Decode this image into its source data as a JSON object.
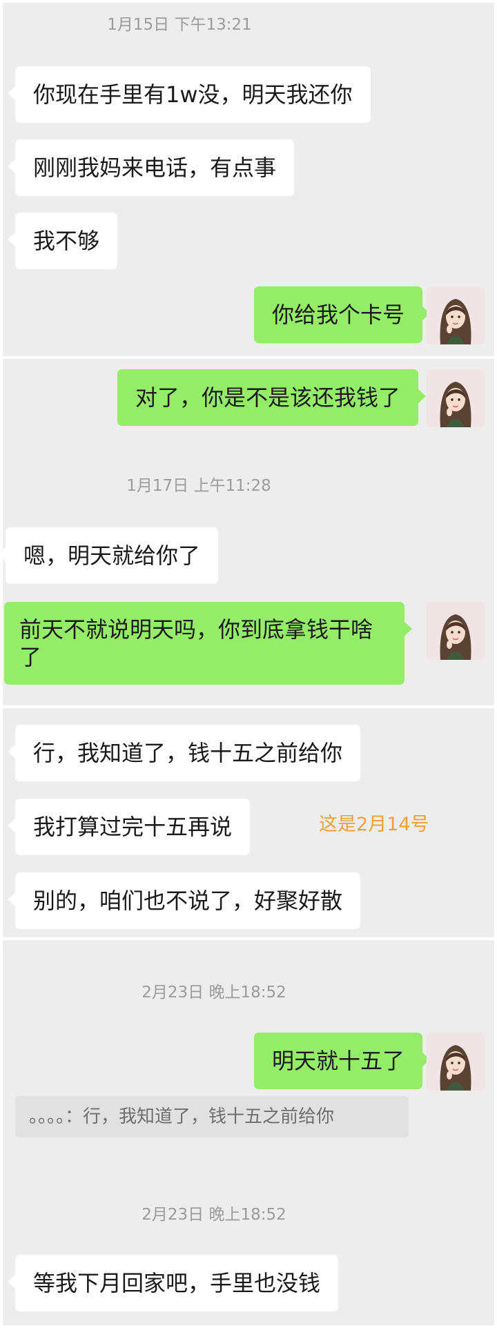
{
  "timestamps": [
    "1月15日 下午13:21",
    "1月17日 上午11:28",
    "2月23日 晚上18:52",
    "2月23日 晚上18:52"
  ],
  "messages": [
    {
      "text": "你现在手里有1w没，明天我还你",
      "side": "left"
    },
    {
      "text": "刚刚我妈来电话，有点事",
      "side": "left"
    },
    {
      "text": "我不够",
      "side": "left"
    },
    {
      "text": "你给我个卡号",
      "side": "right"
    },
    {
      "text": "对了，你是不是该还我钱了",
      "side": "right"
    },
    {
      "text": "嗯，明天就给你了",
      "side": "left"
    },
    {
      "text": "前天不就说明天吗，你到底拿钱干啥了",
      "side": "right"
    },
    {
      "text": "行，我知道了，钱十五之前给你",
      "side": "left"
    },
    {
      "text": "我打算过完十五再说",
      "side": "left"
    },
    {
      "text": "别的，咱们也不说了，好聚好散",
      "side": "left"
    },
    {
      "text": "明天就十五了",
      "side": "right"
    },
    {
      "text": "等我下月回家吧，手里也没钱",
      "side": "left"
    }
  ],
  "quote": {
    "text": "。。。。：行，我知道了，钱十五之前给你"
  },
  "annotation": {
    "text": "这是2月14号",
    "color": "#f2a13a"
  },
  "avatar": {
    "icon": "girl-portrait-icon"
  },
  "colors": {
    "background": "#ededed",
    "sent_bubble": "#95ec69",
    "received_bubble": "#ffffff"
  }
}
